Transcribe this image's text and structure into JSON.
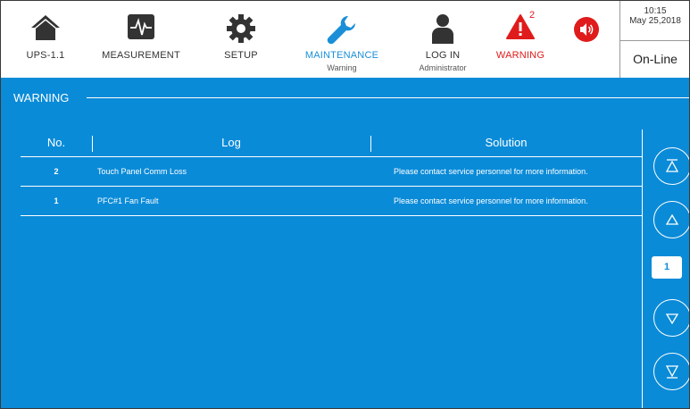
{
  "nav": {
    "ups": {
      "label": "UPS-1.1",
      "icon": "home-icon"
    },
    "measurement": {
      "label": "MEASUREMENT",
      "icon": "waveform-icon"
    },
    "setup": {
      "label": "SETUP",
      "icon": "gear-icon"
    },
    "maintenance": {
      "label": "MAINTENANCE",
      "sub": "Warning",
      "icon": "wrench-icon"
    },
    "login": {
      "label": "LOG IN",
      "sub": "Administrator",
      "icon": "user-icon"
    },
    "warning": {
      "label": "WARNING",
      "count": "2",
      "icon": "warning-triangle-icon"
    },
    "sound": {
      "icon": "speaker-icon"
    }
  },
  "status": {
    "time": "10:15",
    "date": "May 25,2018",
    "mode": "On-Line"
  },
  "section": {
    "title": "WARNING"
  },
  "table": {
    "headers": {
      "no": "No.",
      "log": "Log",
      "solution": "Solution"
    },
    "rows": [
      {
        "no": "2",
        "log": "Touch Panel Comm Loss",
        "solution": "Please contact service personnel for more information."
      },
      {
        "no": "1",
        "log": "PFC#1 Fan Fault",
        "solution": "Please contact service personnel for more information."
      }
    ]
  },
  "pager": {
    "page": "1"
  },
  "colors": {
    "accent": "#0a8bd8",
    "active": "#1a8fd8",
    "alert": "#e01b1b",
    "icon": "#333333"
  }
}
